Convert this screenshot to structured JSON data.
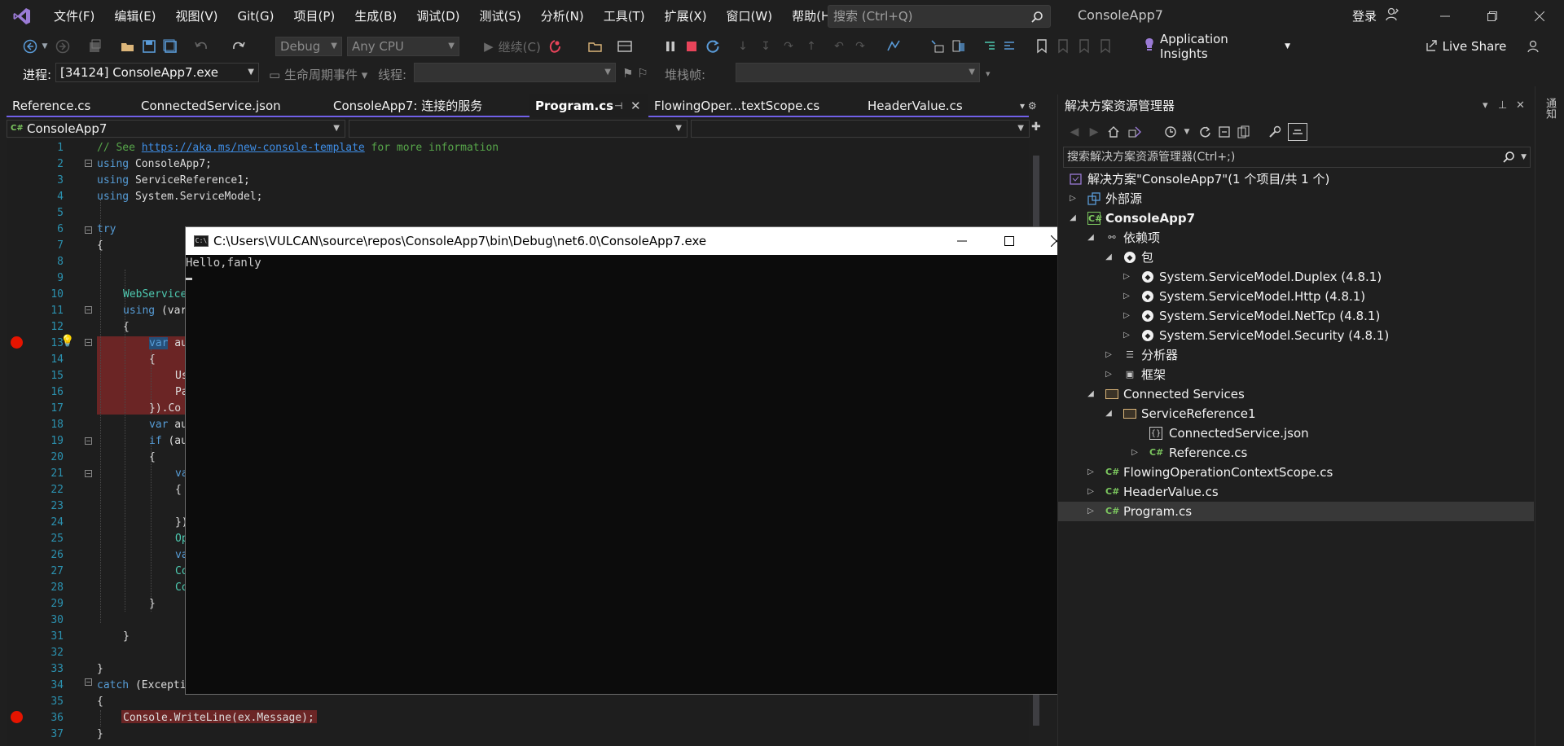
{
  "menubar": {
    "items": [
      "文件(F)",
      "编辑(E)",
      "视图(V)",
      "Git(G)",
      "项目(P)",
      "生成(B)",
      "调试(D)",
      "测试(S)",
      "分析(N)",
      "工具(T)",
      "扩展(X)",
      "窗口(W)",
      "帮助(H)"
    ],
    "search_placeholder": "搜索 (Ctrl+Q)",
    "app_title": "ConsoleApp7",
    "login": "登录"
  },
  "toolbar": {
    "config": "Debug",
    "platform": "Any CPU",
    "continue": "继续(C)",
    "app_insights": "Application Insights",
    "live_share": "Live Share"
  },
  "debugbar": {
    "process_label": "进程:",
    "process_value": "[34124] ConsoleApp7.exe",
    "lifecycle": "生命周期事件",
    "thread_label": "线程:",
    "stackframe_label": "堆栈帧:"
  },
  "doc_tabs": [
    "Reference.cs",
    "ConnectedService.json",
    "ConsoleApp7: 连接的服务",
    "Program.cs",
    "FlowingOper...textScope.cs",
    "HeaderValue.cs"
  ],
  "navbar": {
    "project": "ConsoleApp7"
  },
  "editor": {
    "line_numbers": [
      "1",
      "2",
      "3",
      "4",
      "5",
      "6",
      "7",
      "8",
      "9",
      "10",
      "11",
      "12",
      "13",
      "14",
      "15",
      "16",
      "17",
      "18",
      "19",
      "20",
      "21",
      "22",
      "23",
      "24",
      "25",
      "26",
      "27",
      "28",
      "29",
      "30",
      "31",
      "32",
      "33",
      "34",
      "35",
      "36",
      "37"
    ],
    "lines": {
      "l1_comment": "// See ",
      "l1_link": "https://aka.ms/new-console-template",
      "l1_tail": " for more information",
      "using": "using",
      "l2_ns": " ConsoleApp7;",
      "l3_ns": " ServiceReference1;",
      "l4_ns": " System.ServiceModel;",
      "l6": "try",
      "l7": "{",
      "l10": "WebService",
      "l11_kw": "using",
      "l11_tail": " (var",
      "l12": "{",
      "l13_kw": "var",
      "l13_tail": " au",
      "l14": "{",
      "l15": "Us",
      "l16": "Pa",
      "l17": "}).Co",
      "l18_kw": "var",
      "l18_tail": " au",
      "l19_kw": "if",
      "l19_tail": " (au",
      "l20": "{",
      "l21": "va",
      "l22": "{",
      "l24": "})",
      "l25": "Op",
      "l26": "va",
      "l27": "Co",
      "l28": "Co",
      "l29": "}",
      "l31": "}",
      "l33": "}",
      "l34_kw": "catch",
      "l34_tail": " (Excepti",
      "l35": "{",
      "l36": "Console.WriteLine(ex.Message);",
      "l37": "}"
    }
  },
  "console": {
    "title": "C:\\Users\\VULCAN\\source\\repos\\ConsoleApp7\\bin\\Debug\\net6.0\\ConsoleApp7.exe",
    "icon_text": "C:\\",
    "output": "Hello,fanly"
  },
  "solution_explorer": {
    "title": "解决方案资源管理器",
    "search_placeholder": "搜索解决方案资源管理器(Ctrl+;)",
    "items": [
      "解决方案\"ConsoleApp7\"(1 个项目/共 1 个)",
      "外部源",
      "ConsoleApp7",
      "依赖项",
      "包",
      "System.ServiceModel.Duplex (4.8.1)",
      "System.ServiceModel.Http (4.8.1)",
      "System.ServiceModel.NetTcp (4.8.1)",
      "System.ServiceModel.Security (4.8.1)",
      "分析器",
      "框架",
      "Connected Services",
      "ServiceReference1",
      "ConnectedService.json",
      "Reference.cs",
      "FlowingOperationContextScope.cs",
      "HeaderValue.cs",
      "Program.cs"
    ],
    "cs_badge": "C#",
    "json_badge": "{}",
    "pkg_badge": "◆"
  },
  "right_strip": {
    "label": "通知"
  },
  "colors": {
    "accent": "#7160e8",
    "breakpoint": "#e51400",
    "keyword": "#569cd6",
    "comment": "#57a64a",
    "type": "#4ec9b0",
    "line_number": "#2b91af"
  }
}
